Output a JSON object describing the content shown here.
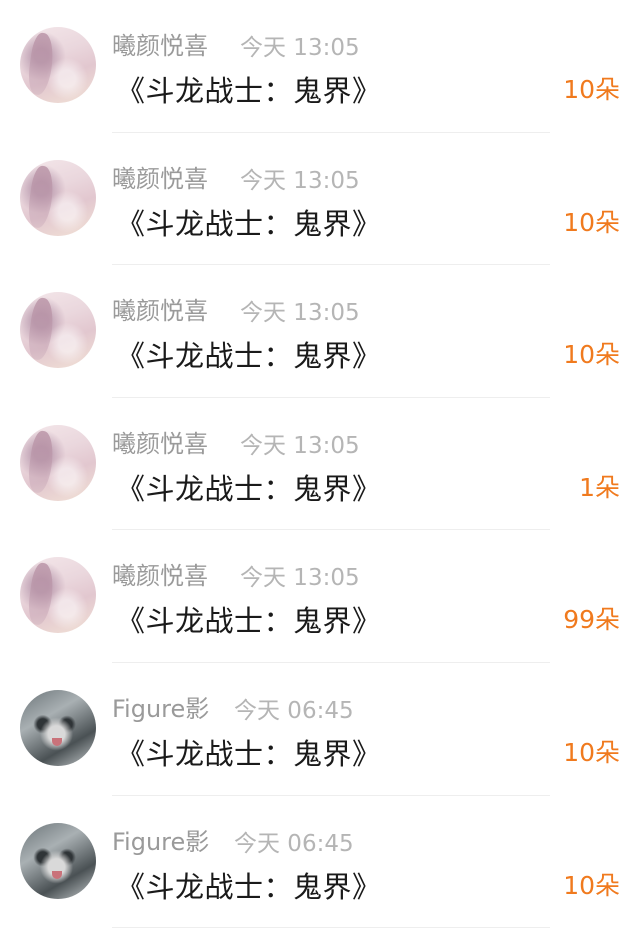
{
  "items": [
    {
      "user": "曦颜悦喜",
      "time": "今天 13:05",
      "title": "《斗龙战士：鬼界》",
      "count": "10朵",
      "avatar": "flower-avatar"
    },
    {
      "user": "曦颜悦喜",
      "time": "今天 13:05",
      "title": "《斗龙战士：鬼界》",
      "count": "10朵",
      "avatar": "flower-avatar"
    },
    {
      "user": "曦颜悦喜",
      "time": "今天 13:05",
      "title": "《斗龙战士：鬼界》",
      "count": "10朵",
      "avatar": "flower-avatar"
    },
    {
      "user": "曦颜悦喜",
      "time": "今天 13:05",
      "title": "《斗龙战士：鬼界》",
      "count": "1朵",
      "avatar": "flower-avatar"
    },
    {
      "user": "曦颜悦喜",
      "time": "今天 13:05",
      "title": "《斗龙战士：鬼界》",
      "count": "99朵",
      "avatar": "flower-avatar"
    },
    {
      "user": "Figure影",
      "time": "今天 06:45",
      "title": "《斗龙战士：鬼界》",
      "count": "10朵",
      "avatar": "cat-avatar"
    },
    {
      "user": "Figure影",
      "time": "今天 06:45",
      "title": "《斗龙战士：鬼界》",
      "count": "10朵",
      "avatar": "cat-avatar"
    }
  ],
  "colors": {
    "count": "#f07a1e",
    "name": "#9a9a9a",
    "time": "#b5b5b5",
    "title": "#1a1a1a"
  }
}
